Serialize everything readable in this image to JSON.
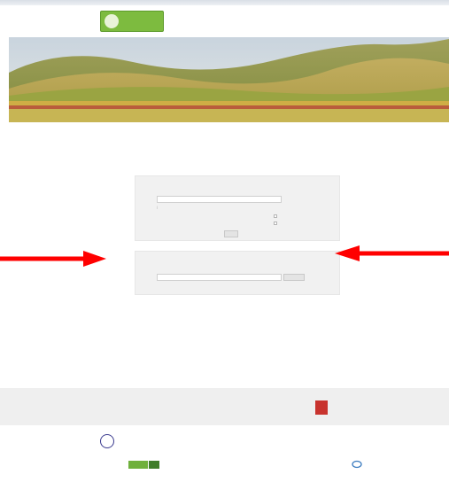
{
  "header": {
    "logo_text": "",
    "nav": [
      "",
      "",
      ""
    ],
    "lang_flags": [
      "",
      ""
    ]
  },
  "subnav": [
    "",
    "",
    "",
    ""
  ],
  "breadcrumb": "",
  "page_title": "",
  "login_box": {
    "title": "",
    "hint": "",
    "username_value": "",
    "forgot_link": "",
    "remember_label": "",
    "options_label": "",
    "submit_label": ""
  },
  "register_box": {
    "title": "",
    "hint": "",
    "email_value": "",
    "submit_label": ""
  },
  "info": {
    "paragraph": "",
    "more_link": ""
  },
  "footer": {
    "band_text": "",
    "band_link": "",
    "badge_text": "",
    "badge_caption": "",
    "access_label": "",
    "access_text": "",
    "partners": [
      "",
      "",
      "",
      "",
      "",
      "",
      "",
      ""
    ]
  },
  "colors": {
    "arrow": "#ff0000",
    "logo_green": "#7dbb3f",
    "badge_red": "#c8332e",
    "link": "#8aa6c8"
  }
}
